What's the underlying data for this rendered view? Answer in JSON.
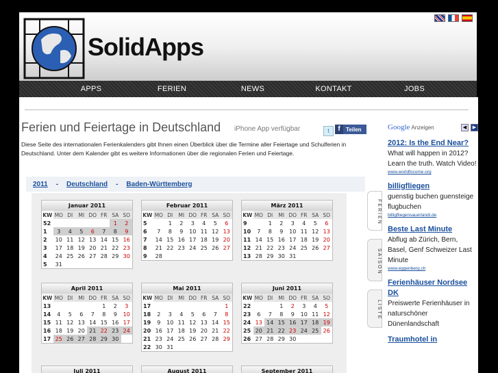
{
  "header": {
    "logo_text": "SolidApps",
    "flags": [
      "uk-flag-icon",
      "fr-flag-icon",
      "es-flag-icon"
    ]
  },
  "nav": [
    "APPS",
    "FERIEN",
    "NEWS",
    "KONTAKT",
    "JOBS"
  ],
  "page": {
    "title": "Ferien und Feiertage in Deutschland",
    "iphone_note": "iPhone App verfügbar",
    "share_label": "Teilen",
    "intro": "Diese Seite des internationalen Ferienkalenders gibt Ihnen einen Überblick über die Termine aller Feiertage und Schulferien in Deutschland. Unter dem Kalender gibt es weitere Informationen über die regionalen Ferien und Feiertage."
  },
  "breadcrumb": [
    "2011",
    "-",
    "Deutschland",
    "-",
    "Baden-Württemberg"
  ],
  "side_tabs": [
    "FERIEN",
    "SAISON",
    "LISTE"
  ],
  "calendar": {
    "header": [
      "KW",
      "MO",
      "DI",
      "MI",
      "DO",
      "FR",
      "SA",
      "SO"
    ],
    "months": [
      {
        "title": "Januar 2011",
        "rows": [
          [
            "52",
            "",
            "",
            "",
            "",
            "",
            "1",
            "2"
          ],
          [
            "1",
            "3",
            "4",
            "5",
            "6",
            "7",
            "8",
            "9"
          ],
          [
            "2",
            "10",
            "11",
            "12",
            "13",
            "14",
            "15",
            "16"
          ],
          [
            "3",
            "17",
            "18",
            "19",
            "20",
            "21",
            "22",
            "23"
          ],
          [
            "4",
            "24",
            "25",
            "26",
            "27",
            "28",
            "29",
            "30"
          ],
          [
            "5",
            "31",
            "",
            "",
            "",
            "",
            "",
            ""
          ]
        ]
      },
      {
        "title": "Februar 2011",
        "rows": [
          [
            "5",
            "",
            "1",
            "2",
            "3",
            "4",
            "5",
            "6"
          ],
          [
            "6",
            "7",
            "8",
            "9",
            "10",
            "11",
            "12",
            "13"
          ],
          [
            "7",
            "14",
            "15",
            "16",
            "17",
            "18",
            "19",
            "20"
          ],
          [
            "8",
            "21",
            "22",
            "23",
            "24",
            "25",
            "26",
            "27"
          ],
          [
            "9",
            "28",
            "",
            "",
            "",
            "",
            "",
            ""
          ]
        ]
      },
      {
        "title": "März 2011",
        "rows": [
          [
            "9",
            "",
            "1",
            "2",
            "3",
            "4",
            "5",
            "6"
          ],
          [
            "10",
            "7",
            "8",
            "9",
            "10",
            "11",
            "12",
            "13"
          ],
          [
            "11",
            "14",
            "15",
            "16",
            "17",
            "18",
            "19",
            "20"
          ],
          [
            "12",
            "21",
            "22",
            "23",
            "24",
            "25",
            "26",
            "27"
          ],
          [
            "13",
            "28",
            "29",
            "30",
            "31",
            "",
            "",
            ""
          ]
        ]
      },
      {
        "title": "April 2011",
        "rows": [
          [
            "13",
            "",
            "",
            "",
            "",
            "1",
            "2",
            "3"
          ],
          [
            "14",
            "4",
            "5",
            "6",
            "7",
            "8",
            "9",
            "10"
          ],
          [
            "15",
            "11",
            "12",
            "13",
            "14",
            "15",
            "16",
            "17"
          ],
          [
            "16",
            "18",
            "19",
            "20",
            "21",
            "22",
            "23",
            "24"
          ],
          [
            "17",
            "25",
            "26",
            "27",
            "28",
            "29",
            "30",
            ""
          ]
        ]
      },
      {
        "title": "Mai 2011",
        "rows": [
          [
            "17",
            "",
            "",
            "",
            "",
            "",
            "",
            "1"
          ],
          [
            "18",
            "2",
            "3",
            "4",
            "5",
            "6",
            "7",
            "8"
          ],
          [
            "19",
            "9",
            "10",
            "11",
            "12",
            "13",
            "14",
            "15"
          ],
          [
            "20",
            "16",
            "17",
            "18",
            "19",
            "20",
            "21",
            "22"
          ],
          [
            "21",
            "23",
            "24",
            "25",
            "26",
            "27",
            "28",
            "29"
          ],
          [
            "22",
            "30",
            "31",
            "",
            "",
            "",
            "",
            ""
          ]
        ]
      },
      {
        "title": "Juni 2011",
        "rows": [
          [
            "22",
            "",
            "",
            "1",
            "2",
            "3",
            "4",
            "5"
          ],
          [
            "23",
            "6",
            "7",
            "8",
            "9",
            "10",
            "11",
            "12"
          ],
          [
            "24",
            "13",
            "14",
            "15",
            "16",
            "17",
            "18",
            "19"
          ],
          [
            "25",
            "20",
            "21",
            "22",
            "23",
            "24",
            "25",
            "26"
          ],
          [
            "26",
            "27",
            "28",
            "29",
            "30",
            "",
            "",
            ""
          ]
        ]
      },
      {
        "title": "Juli 2011",
        "rows": []
      },
      {
        "title": "August 2011",
        "rows": []
      },
      {
        "title": "September 2011",
        "rows": []
      }
    ]
  },
  "ads": {
    "label": "Anzeigen",
    "brand": "Google",
    "items": [
      {
        "title": "2012: Is the End Near?",
        "body": "What will happen in 2012? Learn the truth. Watch Video!",
        "url": "www.worldfocome.org"
      },
      {
        "title": "billigfliegen",
        "body": "guenstig buchen guensteige flugbuchen",
        "url": "billigfliegensauerlandi.de"
      },
      {
        "title": "Beste Last Minute",
        "body": "Abflug ab Zürich, Bern, Basel, Genf Schweizer Last Minute",
        "url": "www.eggenberg.ch"
      },
      {
        "title": "Ferienhäuser Nordsee DK",
        "body": "Preiswerte Ferienhäuser in naturschöner Dünenlandschaft",
        "url": ""
      },
      {
        "title": "Traumhotel in",
        "body": "",
        "url": ""
      }
    ]
  },
  "colors": {
    "nav_bg": "#2f2f2f",
    "link": "#1a4f9c",
    "holiday": "#cc0000",
    "ferien_bg": "#cfcfcf"
  }
}
